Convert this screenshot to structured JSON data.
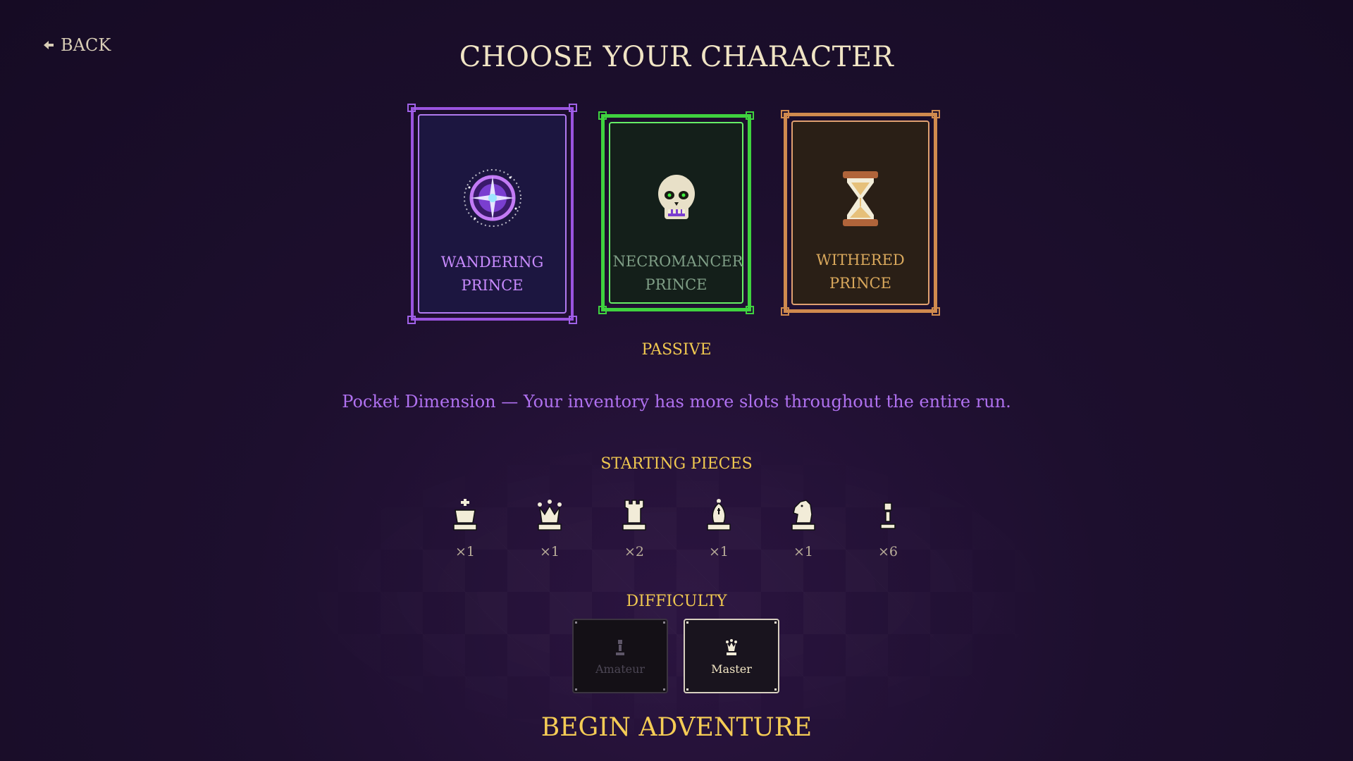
{
  "header": {
    "back_label": "BACK",
    "back_icon": "arrow-left-icon",
    "title": "CHOOSE YOUR CHARACTER"
  },
  "characters": [
    {
      "line1": "WANDERING",
      "line2": "PRINCE",
      "icon": "compass-star-icon",
      "frame_color": "#9b54e0",
      "selected": true
    },
    {
      "line1": "NECROMANCER",
      "line2": "PRINCE",
      "icon": "skull-icon",
      "frame_color": "#3fd23f",
      "selected": false
    },
    {
      "line1": "WITHERED",
      "line2": "PRINCE",
      "icon": "hourglass-icon",
      "frame_color": "#d08a4e",
      "selected": false
    }
  ],
  "passive": {
    "label": "PASSIVE",
    "text": "Pocket Dimension — Your inventory has more slots throughout the entire run."
  },
  "starting_pieces": {
    "label": "STARTING PIECES",
    "pieces": [
      {
        "icon": "king-icon",
        "count": "×1"
      },
      {
        "icon": "queen-icon",
        "count": "×1"
      },
      {
        "icon": "rook-icon",
        "count": "×2"
      },
      {
        "icon": "bishop-icon",
        "count": "×1"
      },
      {
        "icon": "knight-icon",
        "count": "×1"
      },
      {
        "icon": "pawn-icon",
        "count": "×6"
      }
    ]
  },
  "difficulty": {
    "label": "DIFFICULTY",
    "options": [
      {
        "label": "Amateur",
        "icon": "pawn-icon",
        "selected": false
      },
      {
        "label": "Master",
        "icon": "queen-icon",
        "selected": true
      }
    ]
  },
  "begin_label": "BEGIN ADVENTURE",
  "colors": {
    "background": "#1d0f2e",
    "accent_gold": "#f0c850",
    "passive_purple": "#b071f0",
    "title_cream": "#f0e4c4"
  }
}
